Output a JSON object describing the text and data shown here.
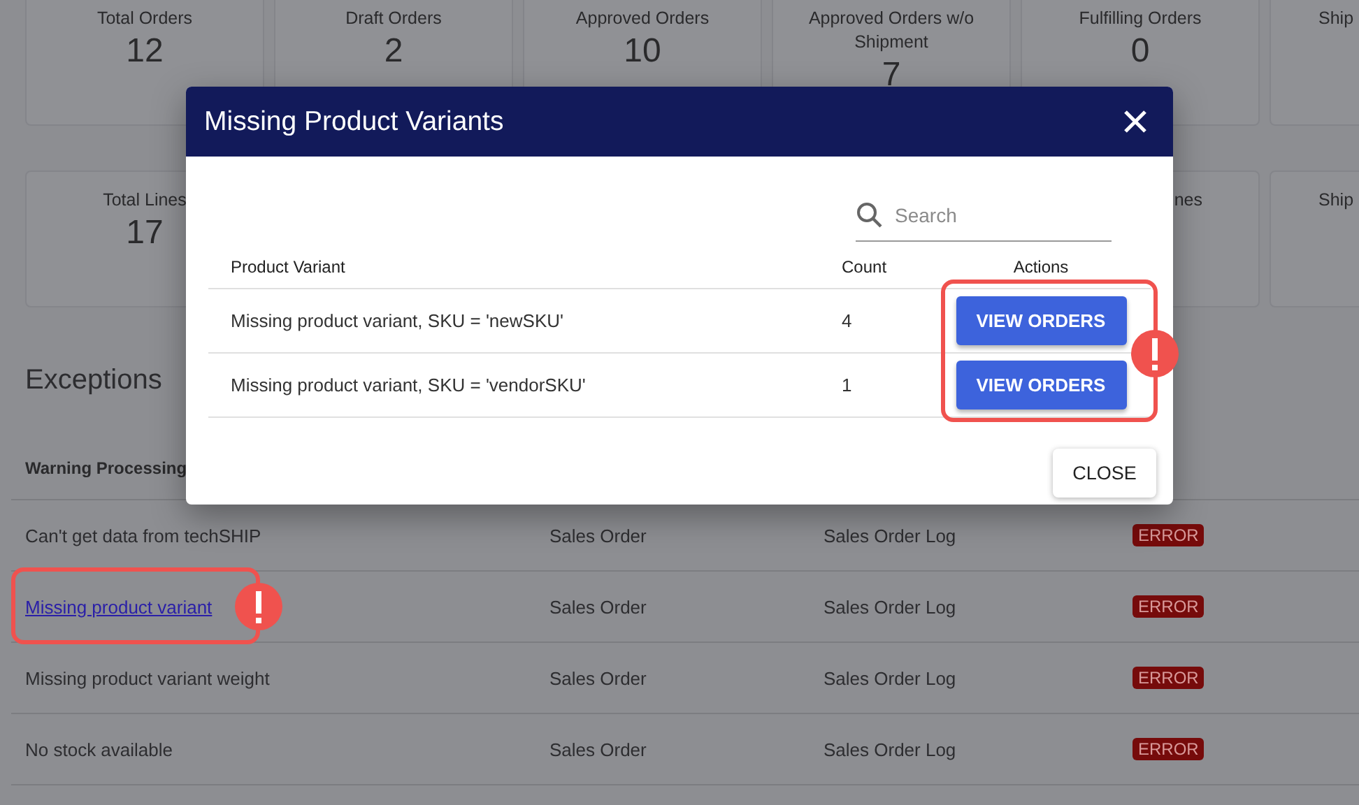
{
  "order_cards": [
    {
      "label": "Total Orders",
      "value": "12"
    },
    {
      "label": "Draft Orders",
      "value": "2"
    },
    {
      "label": "Approved Orders",
      "value": "10"
    },
    {
      "label": "Approved Orders w/o Shipment",
      "value": "7"
    },
    {
      "label": "Fulfilling Orders",
      "value": "0"
    },
    {
      "label": "Ship",
      "kind": "cut_right"
    }
  ],
  "line_cards": [
    {
      "label": "Total Lines",
      "value": "17"
    },
    {
      "kind": "covered"
    },
    {
      "kind": "covered"
    },
    {
      "kind": "covered"
    },
    {
      "label": "nes",
      "kind": "cut_left"
    },
    {
      "label": "Ship",
      "kind": "cut_right"
    }
  ],
  "exceptions": {
    "title": "Exceptions",
    "columns": [
      "Warning Processing"
    ],
    "rows": [
      {
        "cells": [
          "Can't get data from techSHIP",
          "Sales Order",
          "Sales Order Log"
        ],
        "status": "ERROR",
        "link": false,
        "highlighted": false
      },
      {
        "cells": [
          "Missing product variant",
          "Sales Order",
          "Sales Order Log"
        ],
        "status": "ERROR",
        "link": true,
        "highlighted": true
      },
      {
        "cells": [
          "Missing product variant weight",
          "Sales Order",
          "Sales Order Log"
        ],
        "status": "ERROR",
        "link": false,
        "highlighted": false
      },
      {
        "cells": [
          "No stock available",
          "Sales Order",
          "Sales Order Log"
        ],
        "status": "ERROR",
        "link": false,
        "highlighted": false
      }
    ]
  },
  "modal": {
    "title": "Missing Product Variants",
    "search": {
      "placeholder": "Search"
    },
    "columns": [
      "Product Variant",
      "Count",
      "Actions"
    ],
    "rows": [
      {
        "variant": "Missing product variant, SKU = 'newSKU'",
        "count": "4",
        "action": "VIEW ORDERS"
      },
      {
        "variant": "Missing product variant, SKU = 'vendorSKU'",
        "count": "1",
        "action": "VIEW ORDERS"
      }
    ],
    "actions_highlighted": true,
    "close_button": "CLOSE"
  }
}
